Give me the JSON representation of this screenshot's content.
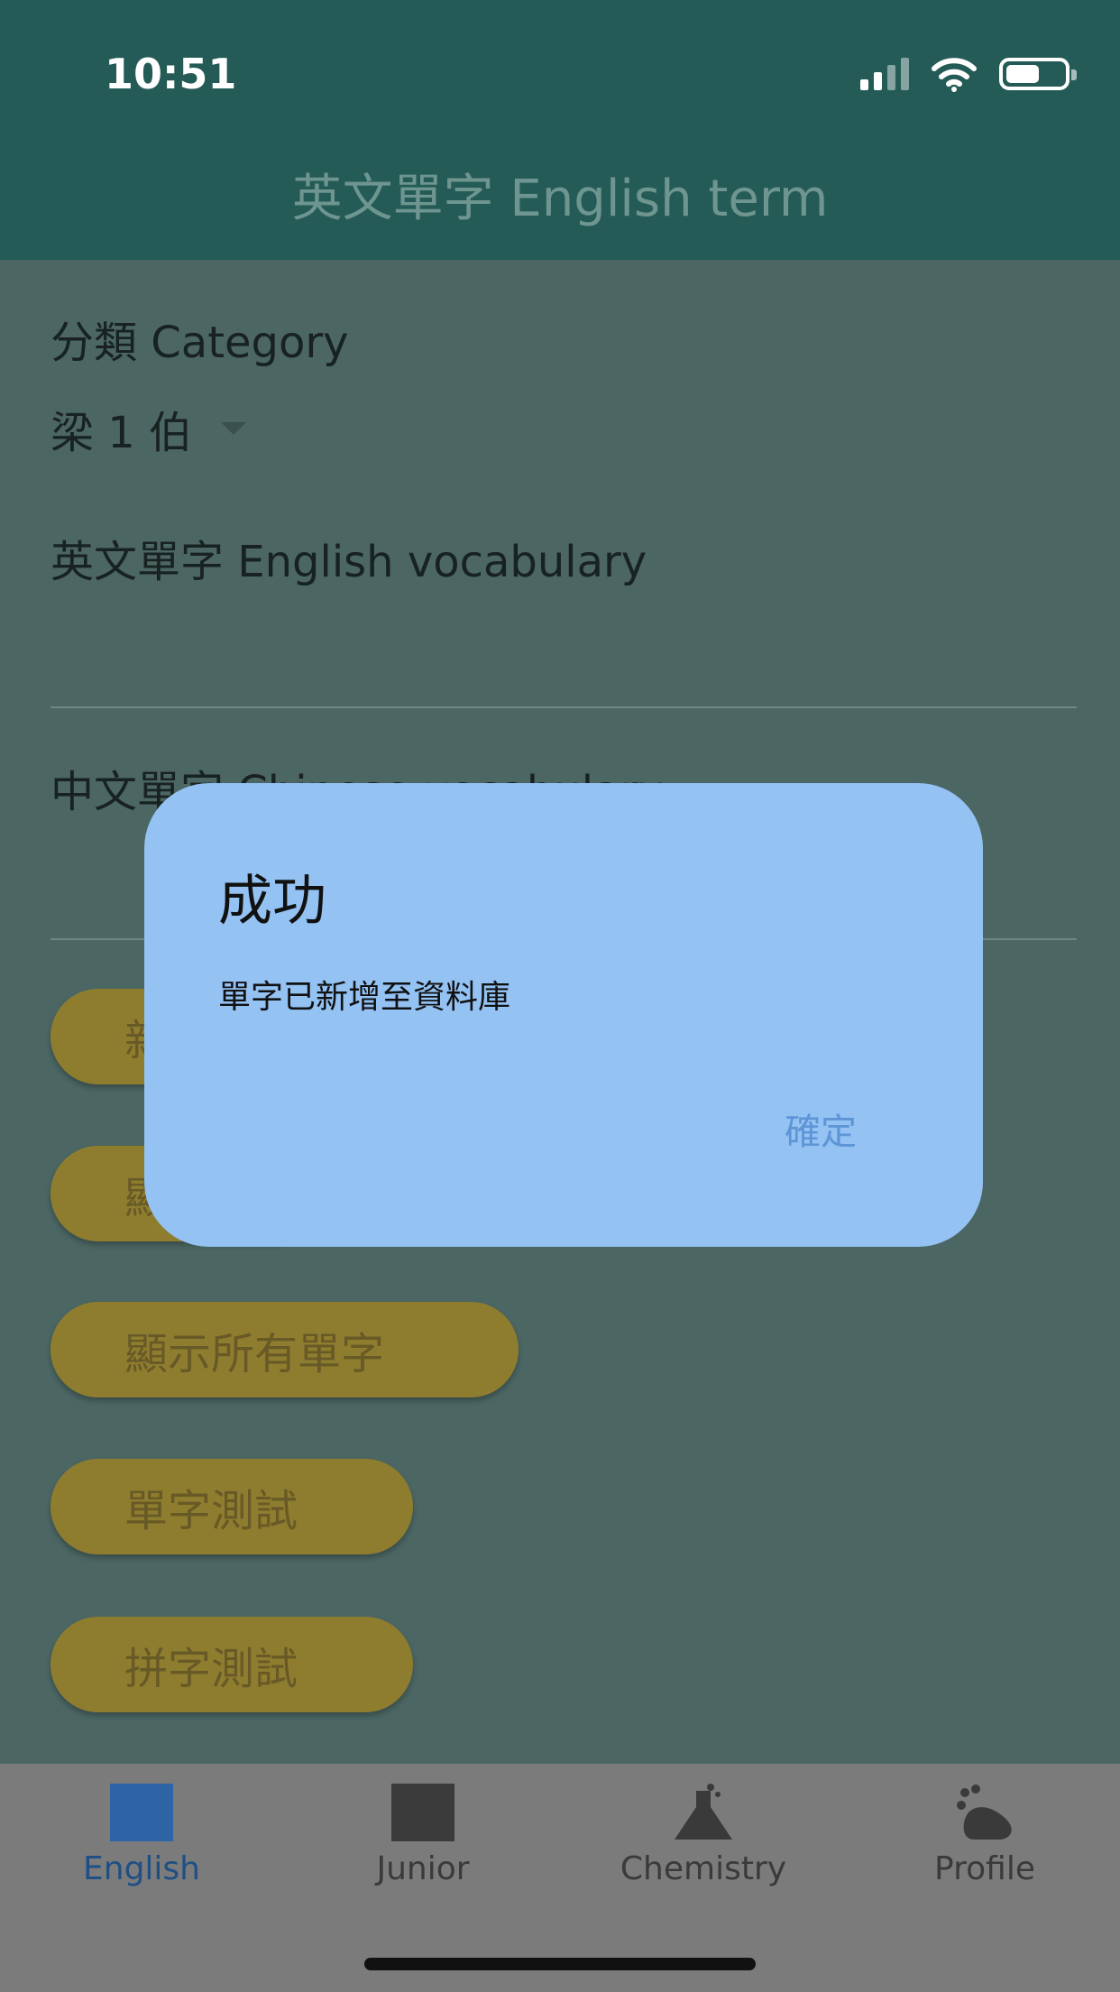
{
  "status_bar": {
    "time": "10:51",
    "icons": [
      "signal-icon",
      "wifi-icon",
      "battery-icon"
    ]
  },
  "header": {
    "title": "英文單字 English term"
  },
  "form": {
    "category_label": "分類 Category",
    "category_value": "梁 1 伯",
    "english_label": "英文單字 English vocabulary",
    "english_value": "",
    "chinese_label": "中文單字 Chinese vocabulary",
    "chinese_value": ""
  },
  "buttons": [
    {
      "label": "新"
    },
    {
      "label": "顯"
    },
    {
      "label": "顯示所有單字"
    },
    {
      "label": "單字測試"
    },
    {
      "label": "拼字測試"
    }
  ],
  "dialog": {
    "title": "成功",
    "message": "單字已新增至資料庫",
    "ok_label": "確定"
  },
  "bottom_nav": {
    "active": "English",
    "items": [
      {
        "label": "English",
        "icon": "square-icon"
      },
      {
        "label": "Junior",
        "icon": "square-icon"
      },
      {
        "label": "Chemistry",
        "icon": "flask-icon"
      },
      {
        "label": "Profile",
        "icon": "footprint-icon"
      }
    ]
  },
  "colors": {
    "header_bg": "#245b56",
    "overlay_bg": "#4b6663",
    "button_bg": "#8f7d2f",
    "dialog_bg": "#93c2f3",
    "dialog_action": "#5e95d6",
    "nav_active": "#1f4f85"
  }
}
